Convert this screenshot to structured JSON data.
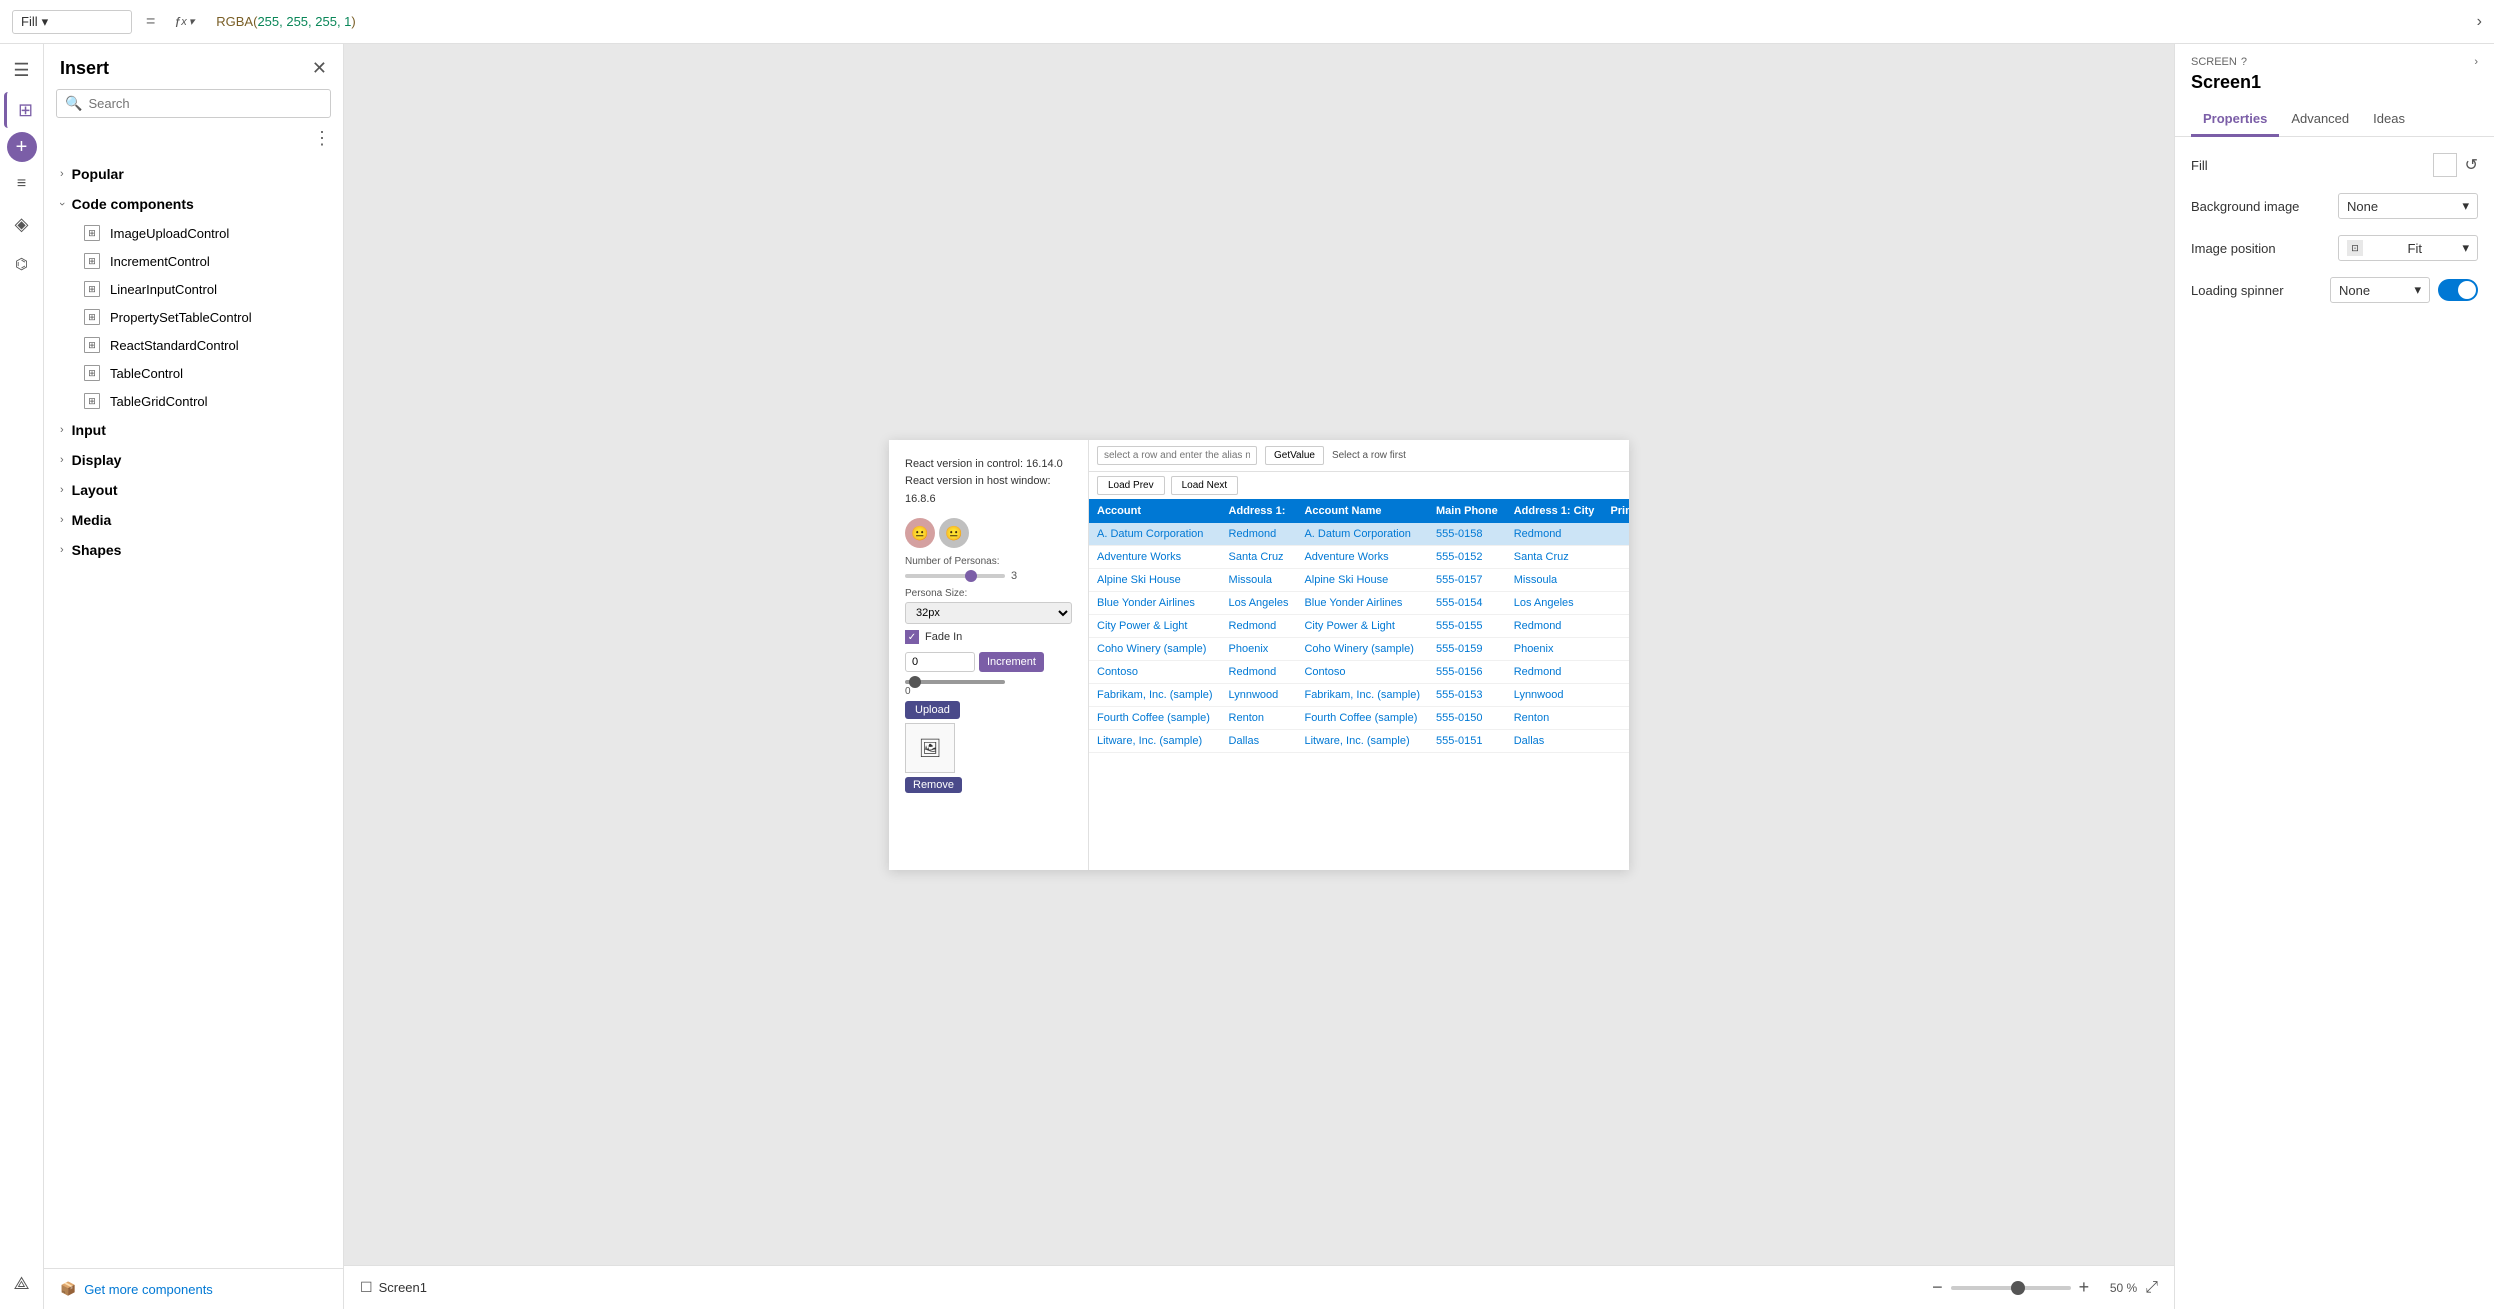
{
  "topbar": {
    "fill_label": "Fill",
    "dropdown_label": "Fill",
    "equals": "=",
    "fx_label": "fx",
    "formula": "RGBA(255, 255, 255, 1)",
    "formula_fn": "RGBA(",
    "formula_nums": "255, 255, 255, 1",
    "formula_close": ")"
  },
  "insert_panel": {
    "title": "Insert",
    "search_placeholder": "Search",
    "sections": [
      {
        "label": "Popular",
        "expanded": false
      },
      {
        "label": "Code components",
        "expanded": true
      },
      {
        "label": "Input",
        "expanded": false
      },
      {
        "label": "Display",
        "expanded": false
      },
      {
        "label": "Layout",
        "expanded": false
      },
      {
        "label": "Media",
        "expanded": false
      },
      {
        "label": "Shapes",
        "expanded": false
      }
    ],
    "code_components": [
      "ImageUploadControl",
      "IncrementControl",
      "LinearInputControl",
      "PropertySetTableControl",
      "ReactStandardControl",
      "TableControl",
      "TableGridControl"
    ],
    "get_more": "Get more components"
  },
  "app_preview": {
    "react_version_control": "React version in control: 16.14.0",
    "react_version_host": "React version in host window: 16.8.6",
    "number_of_personas": "Number of Personas:",
    "persona_size": "Persona Size:",
    "persona_size_value": "32px",
    "fade_in": "Fade In",
    "input_value": "0",
    "increment_btn": "Increment",
    "slider_value": "0",
    "upload_btn": "Upload",
    "remove_btn": "Remove",
    "alias_placeholder": "select a row and enter the alias name",
    "get_value_btn": "GetValue",
    "select_row_hint": "Select a row first",
    "load_prev": "Load Prev",
    "load_next": "Load Next",
    "table": {
      "headers": [
        "Account",
        "Address 1:",
        "Account Name",
        "Main Phone",
        "Address 1: City",
        "Prima..."
      ],
      "rows": [
        {
          "account": "A. Datum Corporation",
          "address1": "Redmond",
          "account_name": "A. Datum Corporation",
          "phone": "555-0158",
          "city": "Redmond"
        },
        {
          "account": "Adventure Works",
          "address1": "Santa Cruz",
          "account_name": "Adventure Works",
          "phone": "555-0152",
          "city": "Santa Cruz"
        },
        {
          "account": "Alpine Ski House",
          "address1": "Missoula",
          "account_name": "Alpine Ski House",
          "phone": "555-0157",
          "city": "Missoula"
        },
        {
          "account": "Blue Yonder Airlines",
          "address1": "Los Angeles",
          "account_name": "Blue Yonder Airlines",
          "phone": "555-0154",
          "city": "Los Angeles"
        },
        {
          "account": "City Power & Light",
          "address1": "Redmond",
          "account_name": "City Power & Light",
          "phone": "555-0155",
          "city": "Redmond"
        },
        {
          "account": "Coho Winery (sample)",
          "address1": "Phoenix",
          "account_name": "Coho Winery (sample)",
          "phone": "555-0159",
          "city": "Phoenix"
        },
        {
          "account": "Contoso",
          "address1": "Redmond",
          "account_name": "Contoso",
          "phone": "555-0156",
          "city": "Redmond"
        },
        {
          "account": "Fabrikam, Inc. (sample)",
          "address1": "Lynnwood",
          "account_name": "Fabrikam, Inc. (sample)",
          "phone": "555-0153",
          "city": "Lynnwood"
        },
        {
          "account": "Fourth Coffee (sample)",
          "address1": "Renton",
          "account_name": "Fourth Coffee (sample)",
          "phone": "555-0150",
          "city": "Renton"
        },
        {
          "account": "Litware, Inc. (sample)",
          "address1": "Dallas",
          "account_name": "Litware, Inc. (sample)",
          "phone": "555-0151",
          "city": "Dallas"
        }
      ]
    }
  },
  "bottom_bar": {
    "screen_name": "Screen1",
    "zoom_value": "50",
    "zoom_unit": "%"
  },
  "right_panel": {
    "screen_label": "SCREEN",
    "screen_name": "Screen1",
    "tabs": [
      "Properties",
      "Advanced",
      "Ideas"
    ],
    "active_tab": "Properties",
    "fill_label": "Fill",
    "background_image_label": "Background image",
    "background_image_value": "None",
    "image_position_label": "Image position",
    "image_position_value": "Fit",
    "loading_spinner_label": "Loading spinner",
    "loading_spinner_value": "None"
  }
}
